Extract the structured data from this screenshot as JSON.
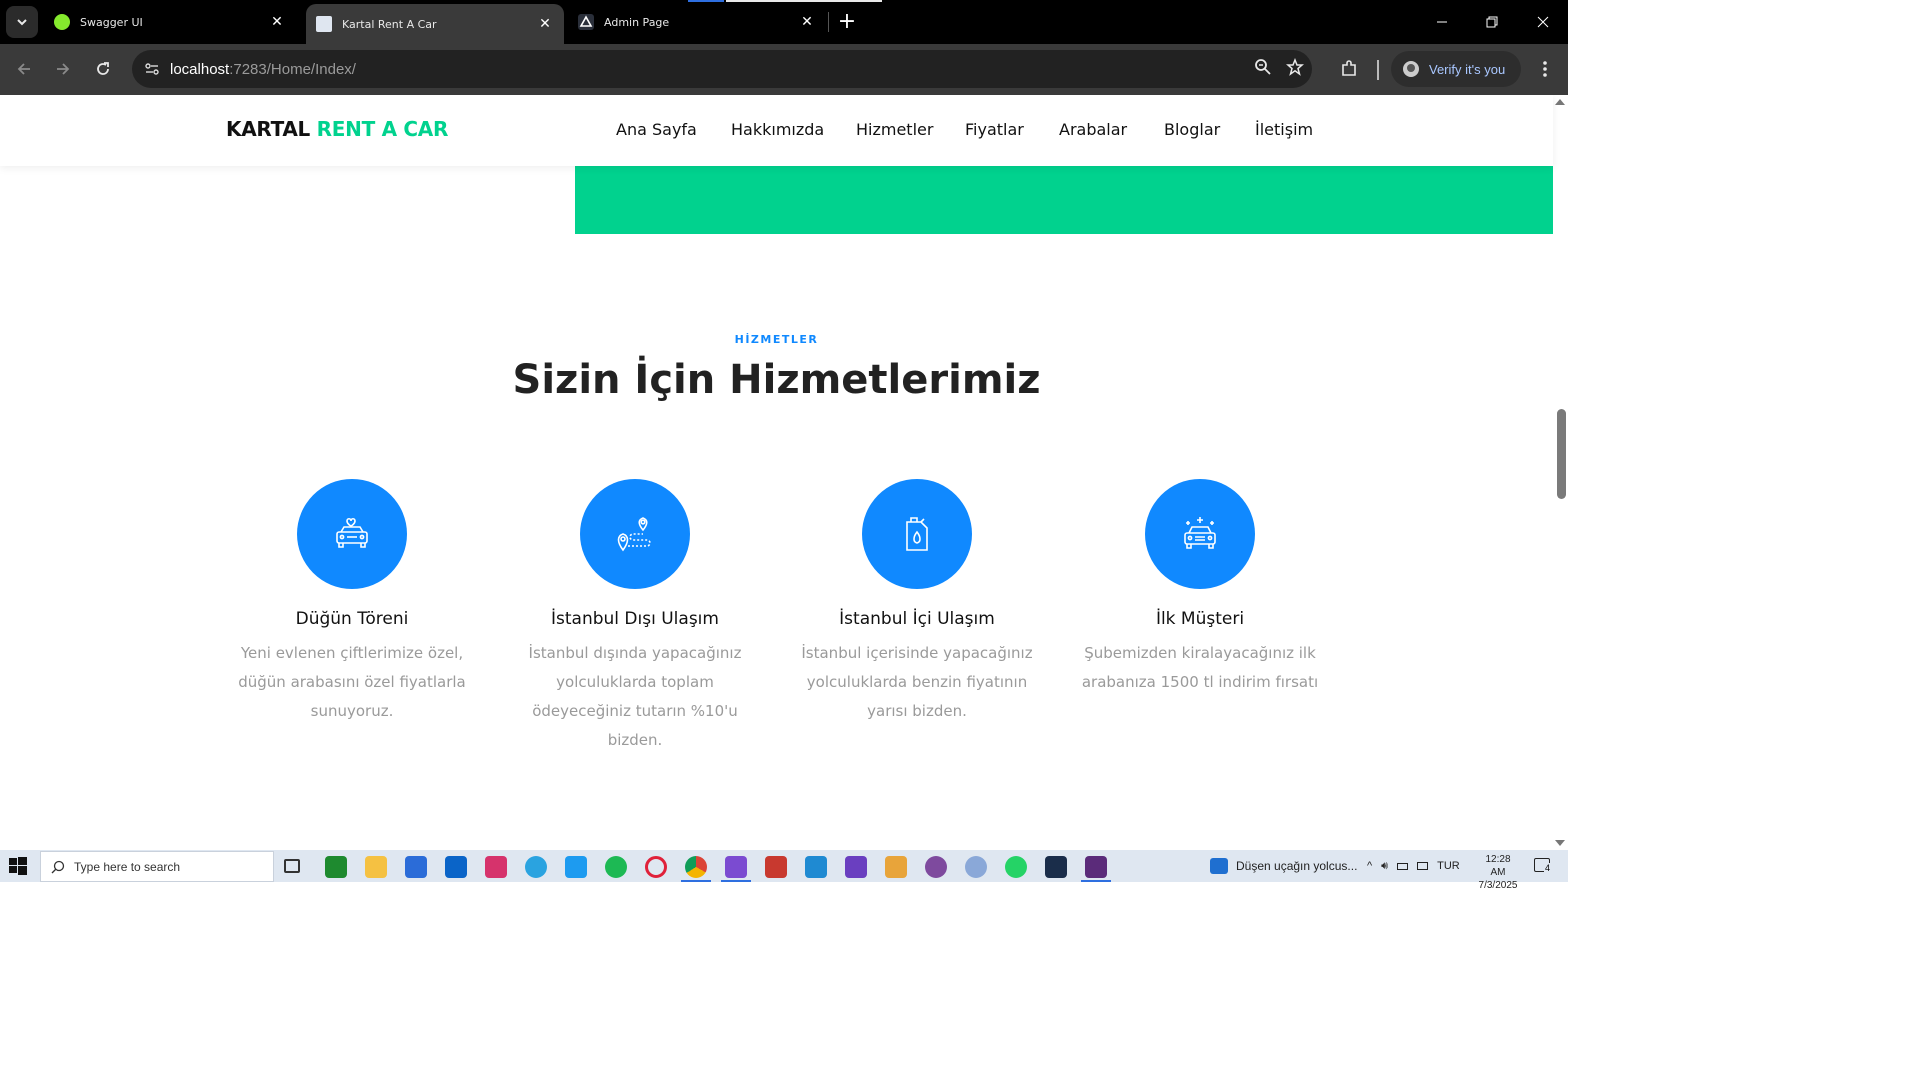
{
  "browser": {
    "tabs": [
      {
        "title": "Swagger UI",
        "favicon": "swagger-icon",
        "active": false
      },
      {
        "title": "Kartal Rent A Car",
        "favicon": "page-icon",
        "active": true
      },
      {
        "title": "Admin Page",
        "favicon": "admin-triangle-icon",
        "active": false
      }
    ],
    "url_host": "localhost",
    "url_rest": ":7283/Home/Index/",
    "profile_label": "Verify it's you"
  },
  "site": {
    "logo_part1": "KARTAL",
    "logo_part2": "RENT A CAR",
    "nav": [
      "Ana Sayfa",
      "Hakkımızda",
      "Hizmetler",
      "Fiyatlar",
      "Arabalar",
      "Bloglar",
      "İletişim"
    ],
    "colors": {
      "brand_green": "#01d28e",
      "accent_blue": "#1089ff"
    }
  },
  "services": {
    "subheading": "HİZMETLER",
    "heading": "Sizin İçin Hizmetlerimiz",
    "items": [
      {
        "icon": "wedding-car-icon",
        "title": "Düğün Töreni",
        "text": "Yeni evlenen çiftlerimize özel, düğün arabasını özel fiyatlarla sunuyoruz."
      },
      {
        "icon": "route-pin-icon",
        "title": "İstanbul Dışı Ulaşım",
        "text": "İstanbul dışında yapacağınız yolculuklarda toplam ödeyeceğiniz tutarın %10'u bizden."
      },
      {
        "icon": "fuel-can-icon",
        "title": "İstanbul İçi Ulaşım",
        "text": "İstanbul içerisinde yapacağınız yolculuklarda benzin fiyatının yarısı bizden."
      },
      {
        "icon": "shiny-car-icon",
        "title": "İlk Müşteri",
        "text": "Şubemizden kiralayacağınız ilk arabanıza 1500 tl indirim fırsatı"
      }
    ]
  },
  "taskbar": {
    "search_placeholder": "Type here to search",
    "news_text": "Düşen uçağın yolcus...",
    "language": "TUR",
    "time": "12:28 AM",
    "date": "7/3/2025",
    "notification_count": "4"
  }
}
